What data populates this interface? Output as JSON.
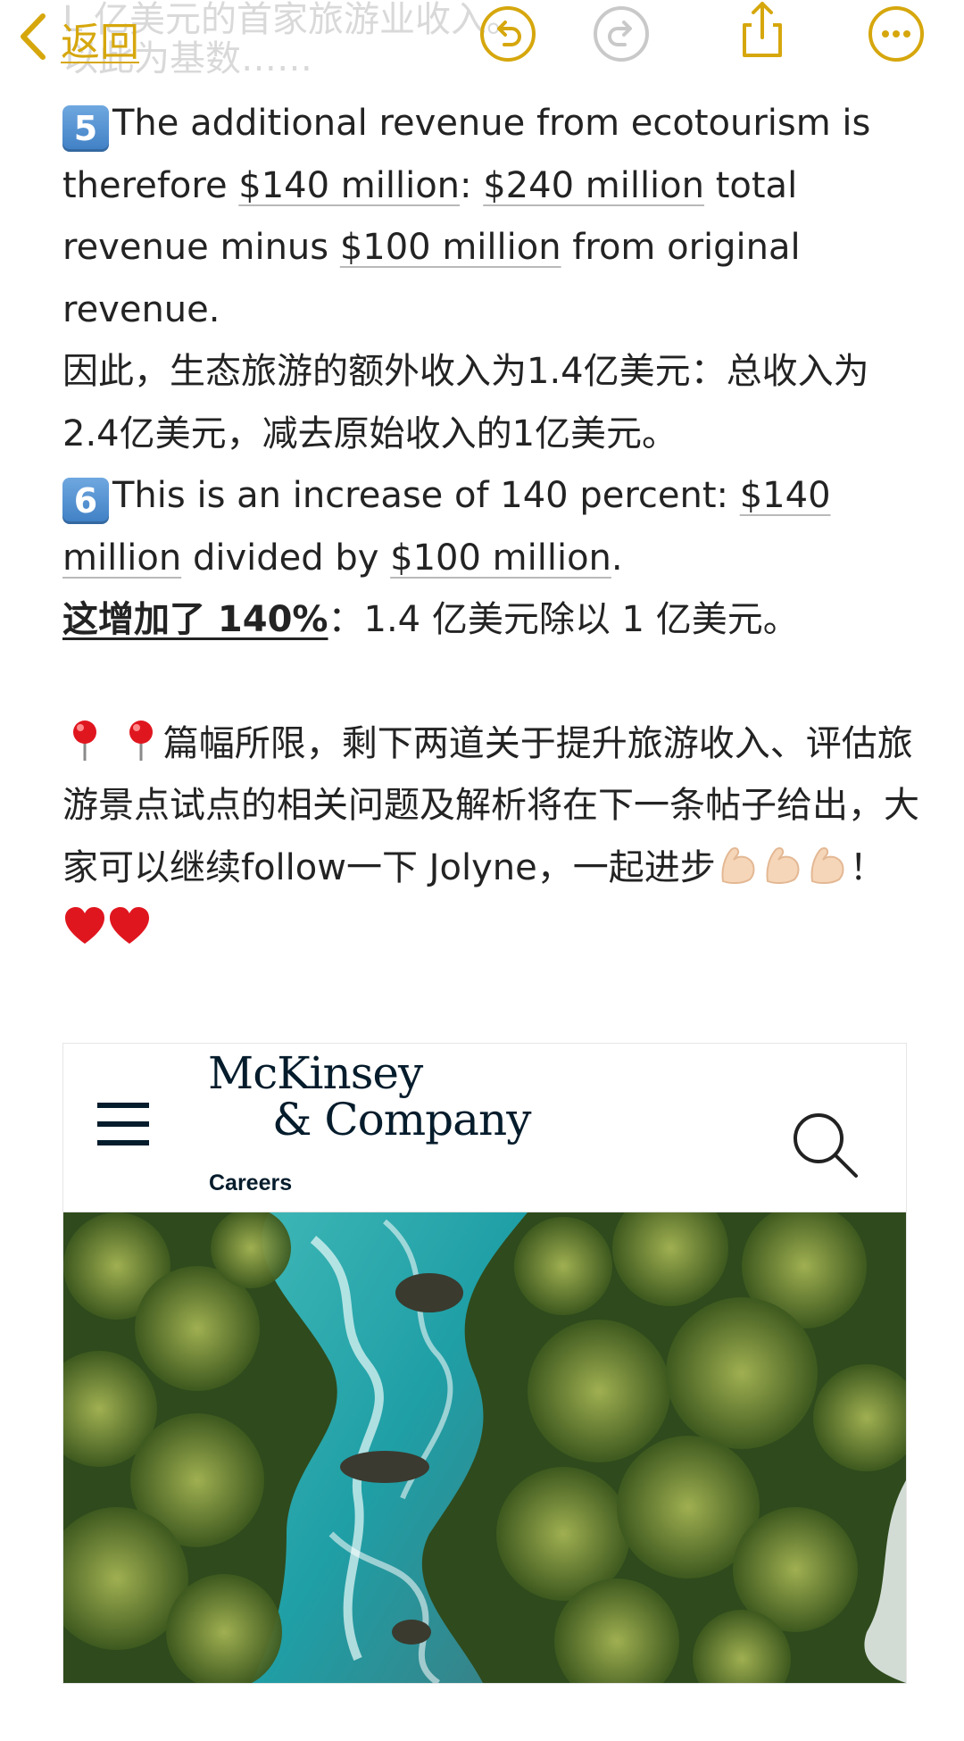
{
  "topbar": {
    "back_label": "返回",
    "ghost_line_1": "L  亿美元的首家旅游业收入。",
    "ghost_line_2": "以此为基数……"
  },
  "note": {
    "p5_num": "5",
    "p5_text_a": "The additional revenue from ecotourism is therefore ",
    "p5_money_1": "$140 million",
    "p5_text_b": ": ",
    "p5_money_2": "$240 million",
    "p5_text_c": " total revenue minus ",
    "p5_money_3": "$100 million",
    "p5_text_d": " from original revenue.",
    "p5_cn": "因此，生态旅游的额外收入为1.4亿美元：总收入为 2.4亿美元，减去原始收入的1亿美元。",
    "p6_num": "6",
    "p6_text_a": "This is an increase of 140 percent: ",
    "p6_money_1": "$140 million",
    "p6_text_b": " divided by ",
    "p6_money_2": "$100 million",
    "p6_text_c": ".",
    "p6_cn_bold": "这增加了 140%",
    "p6_cn_rest": "：1.4 亿美元除以 1 亿美元。",
    "closing_text": "篇幅所限，剩下两道关于提升旅游收入、评估旅游景点试点的相关问题及解析将在下一条帖子给出，大家可以继续follow一下 Jolyne，一起进步",
    "closing_mark": "！"
  },
  "card": {
    "brand_line_1": "McKinsey",
    "brand_line_2": "& Company",
    "section": "Careers"
  },
  "icons": {
    "back": "chevron-left-icon",
    "undo": "undo-icon",
    "redo": "redo-icon",
    "share": "share-icon",
    "more": "more-icon",
    "menu": "hamburger-menu-icon",
    "search": "search-icon"
  },
  "colors": {
    "accent": "#d6a70d",
    "brand_navy": "#051c2c",
    "keycap_blue": "#4a88cc",
    "heart_red": "#e0161f"
  }
}
